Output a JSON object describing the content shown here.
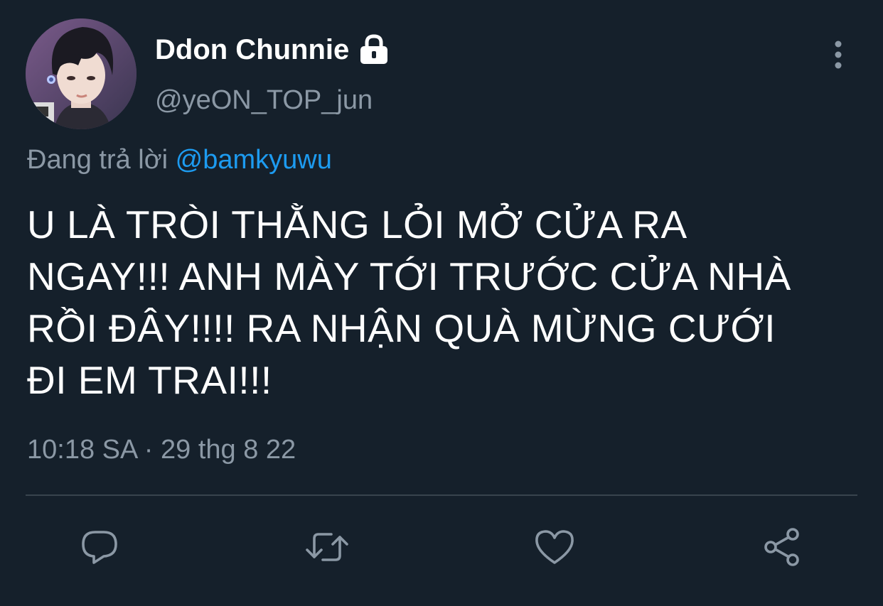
{
  "author": {
    "display_name": "Ddon Chunnie",
    "handle": "@yeON_TOP_jun",
    "protected_icon": "lock-icon",
    "avatar": "profile-photo"
  },
  "reply_context": {
    "prefix": "Đang trả lời",
    "mention": "@bamkyuwu"
  },
  "tweet": {
    "text": "U LÀ TRÒI THẰNG LỎI MỞ CỬA RA\nNGAY!!! ANH MÀY TỚI TRƯỚC CỬA NHÀ\nRỒI ĐÂY!!!! RA NHẬN QUÀ MỪNG CƯỚI\nĐI EM TRAI!!!",
    "timestamp": "10:18 SA · 29 thg 8 22"
  },
  "actions": [
    {
      "name": "reply",
      "icon": "comment-icon"
    },
    {
      "name": "retweet",
      "icon": "retweet-icon"
    },
    {
      "name": "like",
      "icon": "heart-icon"
    },
    {
      "name": "share",
      "icon": "share-icon"
    }
  ],
  "more_menu_icon": "more-vertical-icon",
  "colors": {
    "background": "#15202b",
    "text_primary": "#ffffff",
    "text_secondary": "#8b98a5",
    "link": "#1d9bf0",
    "divider": "#38444d"
  }
}
